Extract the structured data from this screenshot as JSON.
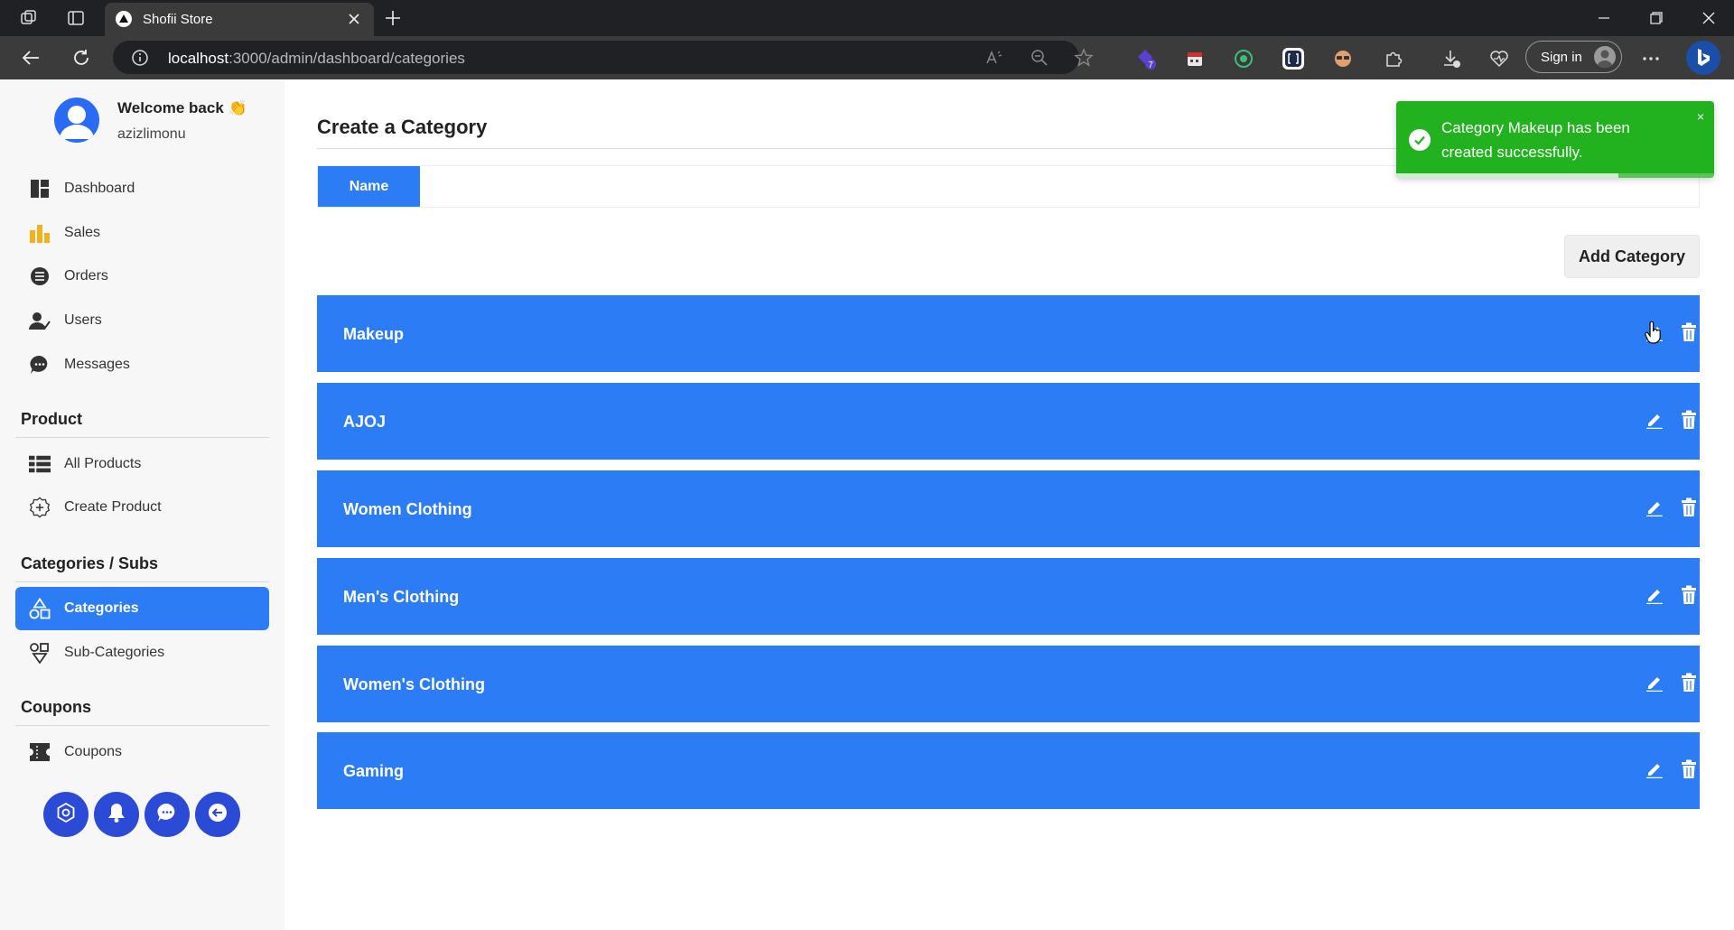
{
  "browser": {
    "tab_title": "Shofii Store",
    "url_host": "localhost",
    "url_path": ":3000/admin/dashboard/categories",
    "signin_label": "Sign in",
    "extension_badge": "7"
  },
  "sidebar": {
    "welcome": "Welcome back 👏",
    "username": "azizlimonu",
    "nav": [
      {
        "label": "Dashboard",
        "icon": "dashboard-icon"
      },
      {
        "label": "Sales",
        "icon": "sales-chart-icon"
      },
      {
        "label": "Orders",
        "icon": "list-icon"
      },
      {
        "label": "Users",
        "icon": "users-icon"
      },
      {
        "label": "Messages",
        "icon": "chat-icon"
      }
    ],
    "product_section": "Product",
    "product_nav": [
      {
        "label": "All Products",
        "icon": "grid-list-icon"
      },
      {
        "label": "Create Product",
        "icon": "plus-circle-icon"
      }
    ],
    "categories_section": "Categories / Subs",
    "categories_nav": [
      {
        "label": "Categories",
        "icon": "shapes-icon",
        "active": true
      },
      {
        "label": "Sub-Categories",
        "icon": "sub-category-icon",
        "active": false
      }
    ],
    "coupons_section": "Coupons",
    "coupons_nav": [
      {
        "label": "Coupons",
        "icon": "ticket-icon"
      }
    ],
    "bottom_buttons": [
      "settings-icon",
      "bell-icon",
      "message-icon",
      "logout-icon"
    ],
    "accent_color": "#2b4bd6"
  },
  "main": {
    "title": "Create a Category",
    "name_label": "Name",
    "name_value": "",
    "add_button": "Add Category",
    "categories": [
      "Makeup",
      "AJOJ",
      "Women Clothing",
      "Men's Clothing",
      "Women's Clothing",
      "Gaming"
    ],
    "row_color": "#2b7cf5"
  },
  "toast": {
    "message": "Category Makeup has been created successfully.",
    "close": "×",
    "progress": 0.7,
    "color": "#22b11f"
  }
}
